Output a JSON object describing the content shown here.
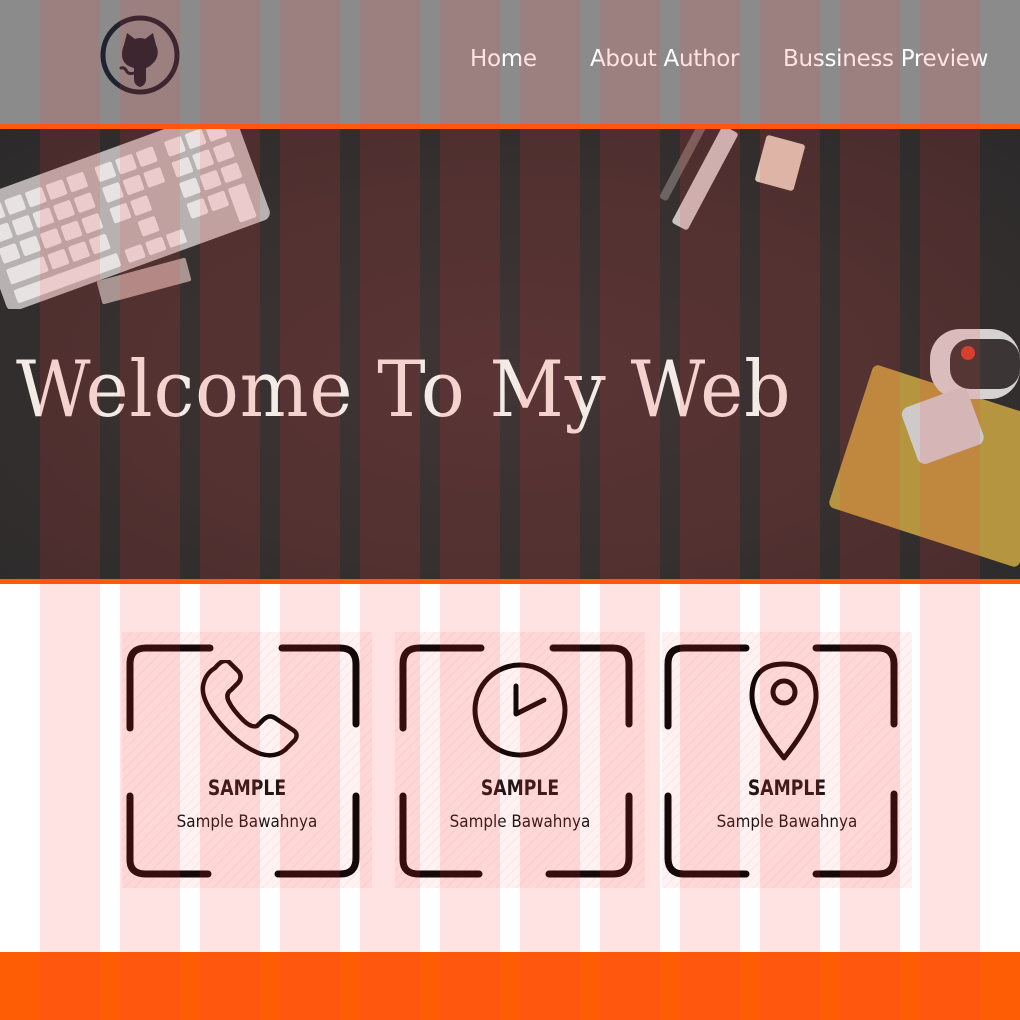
{
  "header": {
    "logo_icon": "github-octocat-icon",
    "nav": [
      {
        "label": "Home"
      },
      {
        "label": "About Author"
      },
      {
        "label": "Bussiness Preview"
      }
    ]
  },
  "hero": {
    "title": "Welcome To My Web"
  },
  "cards": [
    {
      "icon": "phone-icon",
      "title": "SAMPLE",
      "subtitle": "Sample Bawahnya"
    },
    {
      "icon": "clock-icon",
      "title": "SAMPLE",
      "subtitle": "Sample Bawahnya"
    },
    {
      "icon": "map-pin-icon",
      "title": "SAMPLE",
      "subtitle": "Sample Bawahnya"
    }
  ],
  "colors": {
    "accent": "#ff5a0a",
    "header_bg": "#8c8b8b",
    "hero_bg": "#36302f",
    "footer": "#ff5c06",
    "grid_overlay": "#ff3c3c"
  }
}
